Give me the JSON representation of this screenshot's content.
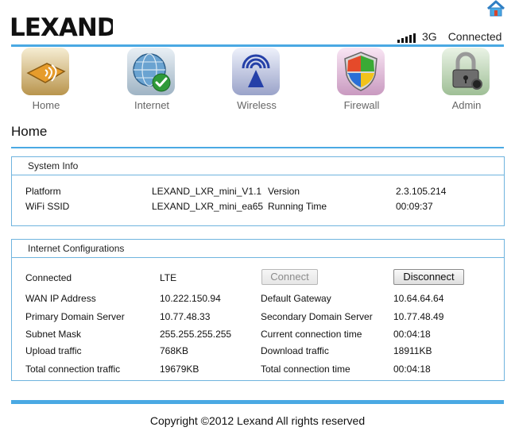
{
  "header": {
    "brand": "LEXAND",
    "network_type": "3G",
    "connection_status": "Connected",
    "signal_bars": 5,
    "home_icon": "home-icon"
  },
  "nav": [
    {
      "label": "Home",
      "icon": "home-nav-icon"
    },
    {
      "label": "Internet",
      "icon": "globe-icon"
    },
    {
      "label": "Wireless",
      "icon": "wireless-icon"
    },
    {
      "label": "Firewall",
      "icon": "shield-icon"
    },
    {
      "label": "Admin",
      "icon": "lock-icon"
    }
  ],
  "page_title": "Home",
  "system_info": {
    "title": "System Info",
    "platform_label": "Platform",
    "platform_value": "LEXAND_LXR_mini_V1.1",
    "version_label": "Version",
    "version_value": "2.3.105.214",
    "ssid_label": "WiFi SSID",
    "ssid_value": "LEXAND_LXR_mini_ea65",
    "running_time_label": "Running Time",
    "running_time_value": "00:09:37"
  },
  "internet_config": {
    "title": "Internet Configurations",
    "connected_label": "Connected",
    "connected_value": "LTE",
    "connect_button": "Connect",
    "disconnect_button": "Disconnect",
    "wan_ip_label": "WAN IP Address",
    "wan_ip_value": "10.222.150.94",
    "gateway_label": "Default Gateway",
    "gateway_value": "10.64.64.64",
    "primary_dns_label": "Primary Domain Server",
    "primary_dns_value": "10.77.48.33",
    "secondary_dns_label": "Secondary Domain Server",
    "secondary_dns_value": "10.77.48.49",
    "subnet_label": "Subnet Mask",
    "subnet_value": "255.255.255.255",
    "current_time_label": "Current connection time",
    "current_time_value": "00:04:18",
    "upload_label": "Upload traffic",
    "upload_value": "768KB",
    "download_label": "Download traffic",
    "download_value": "18911KB",
    "total_traffic_label": "Total connection traffic",
    "total_traffic_value": "19679KB",
    "total_time_label": "Total connection time",
    "total_time_value": "00:04:18"
  },
  "footer": "Copyright ©2012 Lexand All rights reserved",
  "colors": {
    "accent": "#4aa9e3",
    "panel_border": "#6fb4de"
  }
}
